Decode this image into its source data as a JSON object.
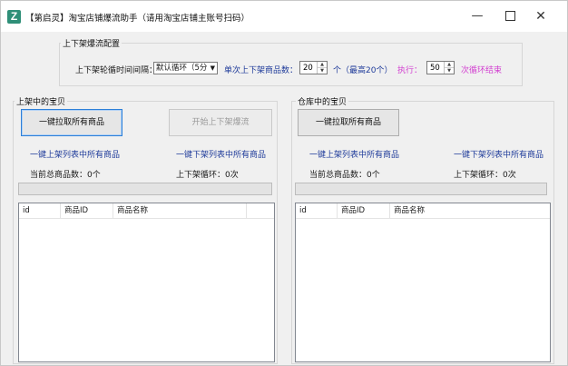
{
  "window": {
    "title": "【第启灵】淘宝店铺爆流助手（请用淘宝店铺主账号扫码）",
    "app_icon_letter": "Z",
    "controls": {
      "minimize": "—",
      "maximize": "",
      "close": "✕"
    }
  },
  "config": {
    "group_title": "上下架爆流配置",
    "interval_label": "上下架轮循时间间隔：",
    "interval_value": "默认循环（5分",
    "count_label": "单次上下架商品数：",
    "count_value": "20",
    "count_suffix": "个（最高20个）",
    "execute_label": "执行：",
    "execute_value": "50",
    "execute_suffix": "次循环结束"
  },
  "left_panel": {
    "group_title": "上架中的宝贝",
    "pull_button": "一键拉取所有商品",
    "start_button": "开始上下架爆流",
    "link_left": "一键上架列表中所有商品",
    "link_right": "一键下架列表中所有商品",
    "total_label": "当前总商品数：0个",
    "cycle_label": "上下架循环：0次",
    "progress": 0,
    "columns": [
      "id",
      "商品ID",
      "商品名称"
    ]
  },
  "right_panel": {
    "group_title": "仓库中的宝贝",
    "pull_button": "一键拉取所有商品",
    "link_left": "一键上架列表中所有商品",
    "link_right": "一键下架列表中所有商品",
    "total_label": "当前总商品数：0个",
    "cycle_label": "上下架循环：0次",
    "progress": 0,
    "columns": [
      "id",
      "商品ID",
      "商品名称"
    ]
  },
  "colors": {
    "link_blue": "#1f3b9a",
    "accent_pink": "#d23fd0",
    "focus_border": "#2d7fd8"
  }
}
